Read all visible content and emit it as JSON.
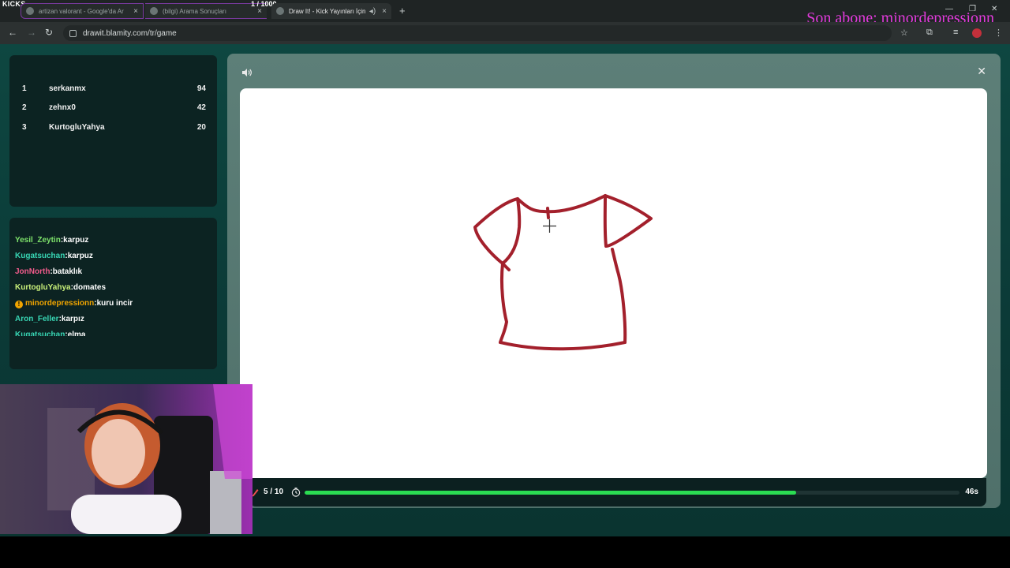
{
  "overlay": {
    "kicks_label": "KICKS",
    "counter": "1  / 1000",
    "subscriber": "Son abone: minordepressionn"
  },
  "browser": {
    "tabs": [
      {
        "title": "artizan valorant - Google'da Ar"
      },
      {
        "title": "(bilgi) Arama Sonuçları"
      },
      {
        "title": "Draw It! - Kick Yayınları İçin"
      }
    ],
    "url": "drawit.blamity.com/tr/game"
  },
  "leaderboard": [
    {
      "rank": "1",
      "name": "serkanmx",
      "score": "94"
    },
    {
      "rank": "2",
      "name": "zehnx0",
      "score": "42"
    },
    {
      "rank": "3",
      "name": "KurtogluYahya",
      "score": "20"
    }
  ],
  "chat": [
    {
      "user": "Yesil_Zeytin",
      "text": "karpuz",
      "color": "#7ee26b"
    },
    {
      "user": "Kugatsuchan",
      "text": "karpuz",
      "color": "#38d6b4"
    },
    {
      "user": "JonNorth",
      "text": "bataklık",
      "color": "#f05b8b"
    },
    {
      "user": "KurtogluYahya",
      "text": "domates",
      "color": "#c9ef7a"
    },
    {
      "user": "minordepressionn",
      "text": "kuru incir",
      "color": "#f1a500"
    },
    {
      "user": "Aron_Feller",
      "text": "karpız",
      "color": "#38d6b4"
    },
    {
      "user": "Kugatsuchan",
      "text": "elma",
      "color": "#38d6b4"
    }
  ],
  "game": {
    "round": "5 / 10",
    "time_left": "46s",
    "progress_fraction": 0.75,
    "stroke_color": "#a3202c"
  }
}
